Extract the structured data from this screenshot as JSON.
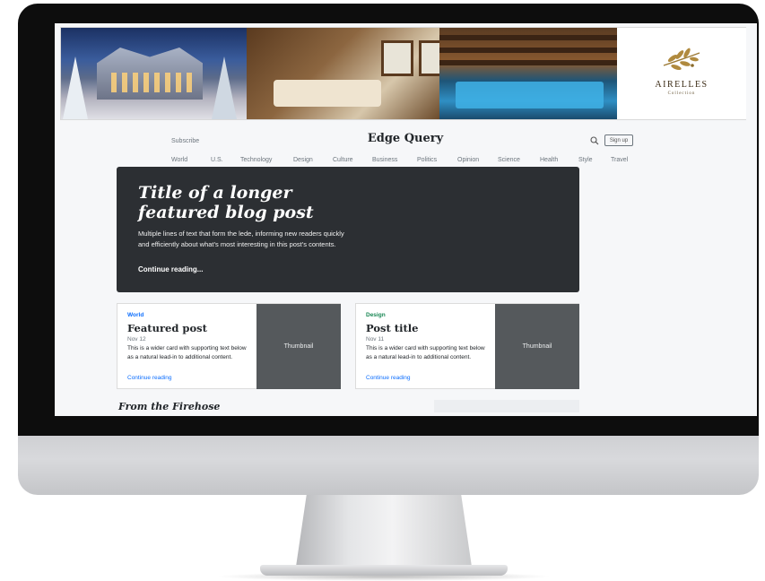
{
  "ad": {
    "brand_name": "AIRELLES",
    "brand_sub": "Collection",
    "photos": [
      "chalet-exterior-photo",
      "bedroom-interior-photo",
      "indoor-pool-photo"
    ]
  },
  "blog": {
    "subscribe": "Subscribe",
    "site_title": "Edge Query",
    "signup": "Sign up",
    "nav": [
      "World",
      "U.S.",
      "Technology",
      "Design",
      "Culture",
      "Business",
      "Politics",
      "Opinion",
      "Science",
      "Health",
      "Style",
      "Travel"
    ],
    "hero": {
      "title": "Title of a longer featured blog post",
      "lede": "Multiple lines of text that form the lede, informing new readers quickly and efficiently about what’s most interesting in this post’s contents.",
      "link": "Continue reading..."
    },
    "cards": [
      {
        "category": "World",
        "title": "Featured post",
        "date": "Nov 12",
        "text": "This is a wider card with supporting text below as a natural lead-in to additional content.",
        "link": "Continue reading",
        "thumbnail": "Thumbnail"
      },
      {
        "category": "Design",
        "title": "Post title",
        "date": "Nov 11",
        "text": "This is a wider card with supporting text below as a natural lead-in to additional content.",
        "link": "Continue reading",
        "thumbnail": "Thumbnail"
      }
    ],
    "section_heading": "From the Firehose"
  },
  "colors": {
    "hero_bg": "#2c2f33",
    "world_accent": "#0d6efd",
    "design_accent": "#198754",
    "thumbnail_bg": "#55595c",
    "brand_gold": "#b08a3e"
  },
  "icons": {
    "search": "search-icon",
    "brand_logo": "olive-branch-logo-icon"
  }
}
